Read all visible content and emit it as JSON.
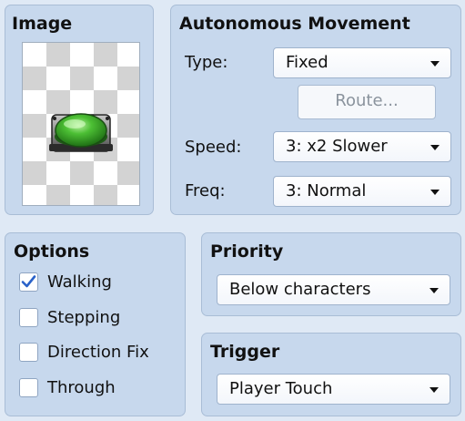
{
  "image_panel": {
    "title": "Image",
    "sprite_icon": "green-switch-button-icon"
  },
  "movement": {
    "title": "Autonomous Movement",
    "type_label": "Type:",
    "type_value": "Fixed",
    "route_label": "Route...",
    "speed_label": "Speed:",
    "speed_value": "3: x2 Slower",
    "freq_label": "Freq:",
    "freq_value": "3: Normal"
  },
  "options": {
    "title": "Options",
    "items": [
      {
        "label": "Walking",
        "checked": true
      },
      {
        "label": "Stepping",
        "checked": false
      },
      {
        "label": "Direction Fix",
        "checked": false
      },
      {
        "label": "Through",
        "checked": false
      }
    ]
  },
  "priority": {
    "title": "Priority",
    "value": "Below characters"
  },
  "trigger": {
    "title": "Trigger",
    "value": "Player Touch"
  },
  "colors": {
    "panel_bg": "#c7d8ed",
    "check_mark": "#2a62c9",
    "switch_green": "#3fae2f"
  }
}
